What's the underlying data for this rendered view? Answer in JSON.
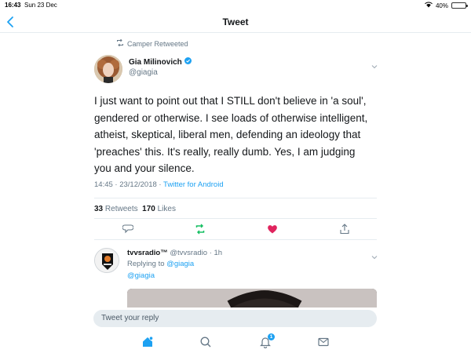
{
  "status_bar": {
    "time": "16:43",
    "date": "Sun 23 Dec",
    "battery": "40%",
    "battery_level": 0.4
  },
  "nav": {
    "title": "Tweet"
  },
  "tweet": {
    "retweet_context": "Camper Retweeted",
    "author_name": "Gia Milinovich",
    "author_handle": "@giagia",
    "text": "I just want to point out that I STILL don't believe in 'a soul', gendered or otherwise. I see loads of otherwise intelligent, atheist, skeptical, liberal men, defending an ideology that 'preaches' this. It's really, really dumb. Yes, I am judging you and your silence.",
    "timestamp": "14:45 · 23/12/2018 · ",
    "source": "Twitter for Android",
    "retweets_count": "33",
    "retweets_label": "Retweets",
    "likes_count": "170",
    "likes_label": "Likes"
  },
  "reply": {
    "author_name": "tvvsradio™",
    "author_handle": "@tvvsradio",
    "age": "· 1h",
    "replying_to_label": "Replying to ",
    "replying_to_handle": "@giagia",
    "mention": "@giagia"
  },
  "composer": {
    "placeholder": "Tweet your reply"
  },
  "tabbar": {
    "notifications_badge": "1"
  },
  "colors": {
    "accent": "#1da1f2",
    "retweet": "#17bf63",
    "like": "#e0245e",
    "muted": "#657786"
  }
}
